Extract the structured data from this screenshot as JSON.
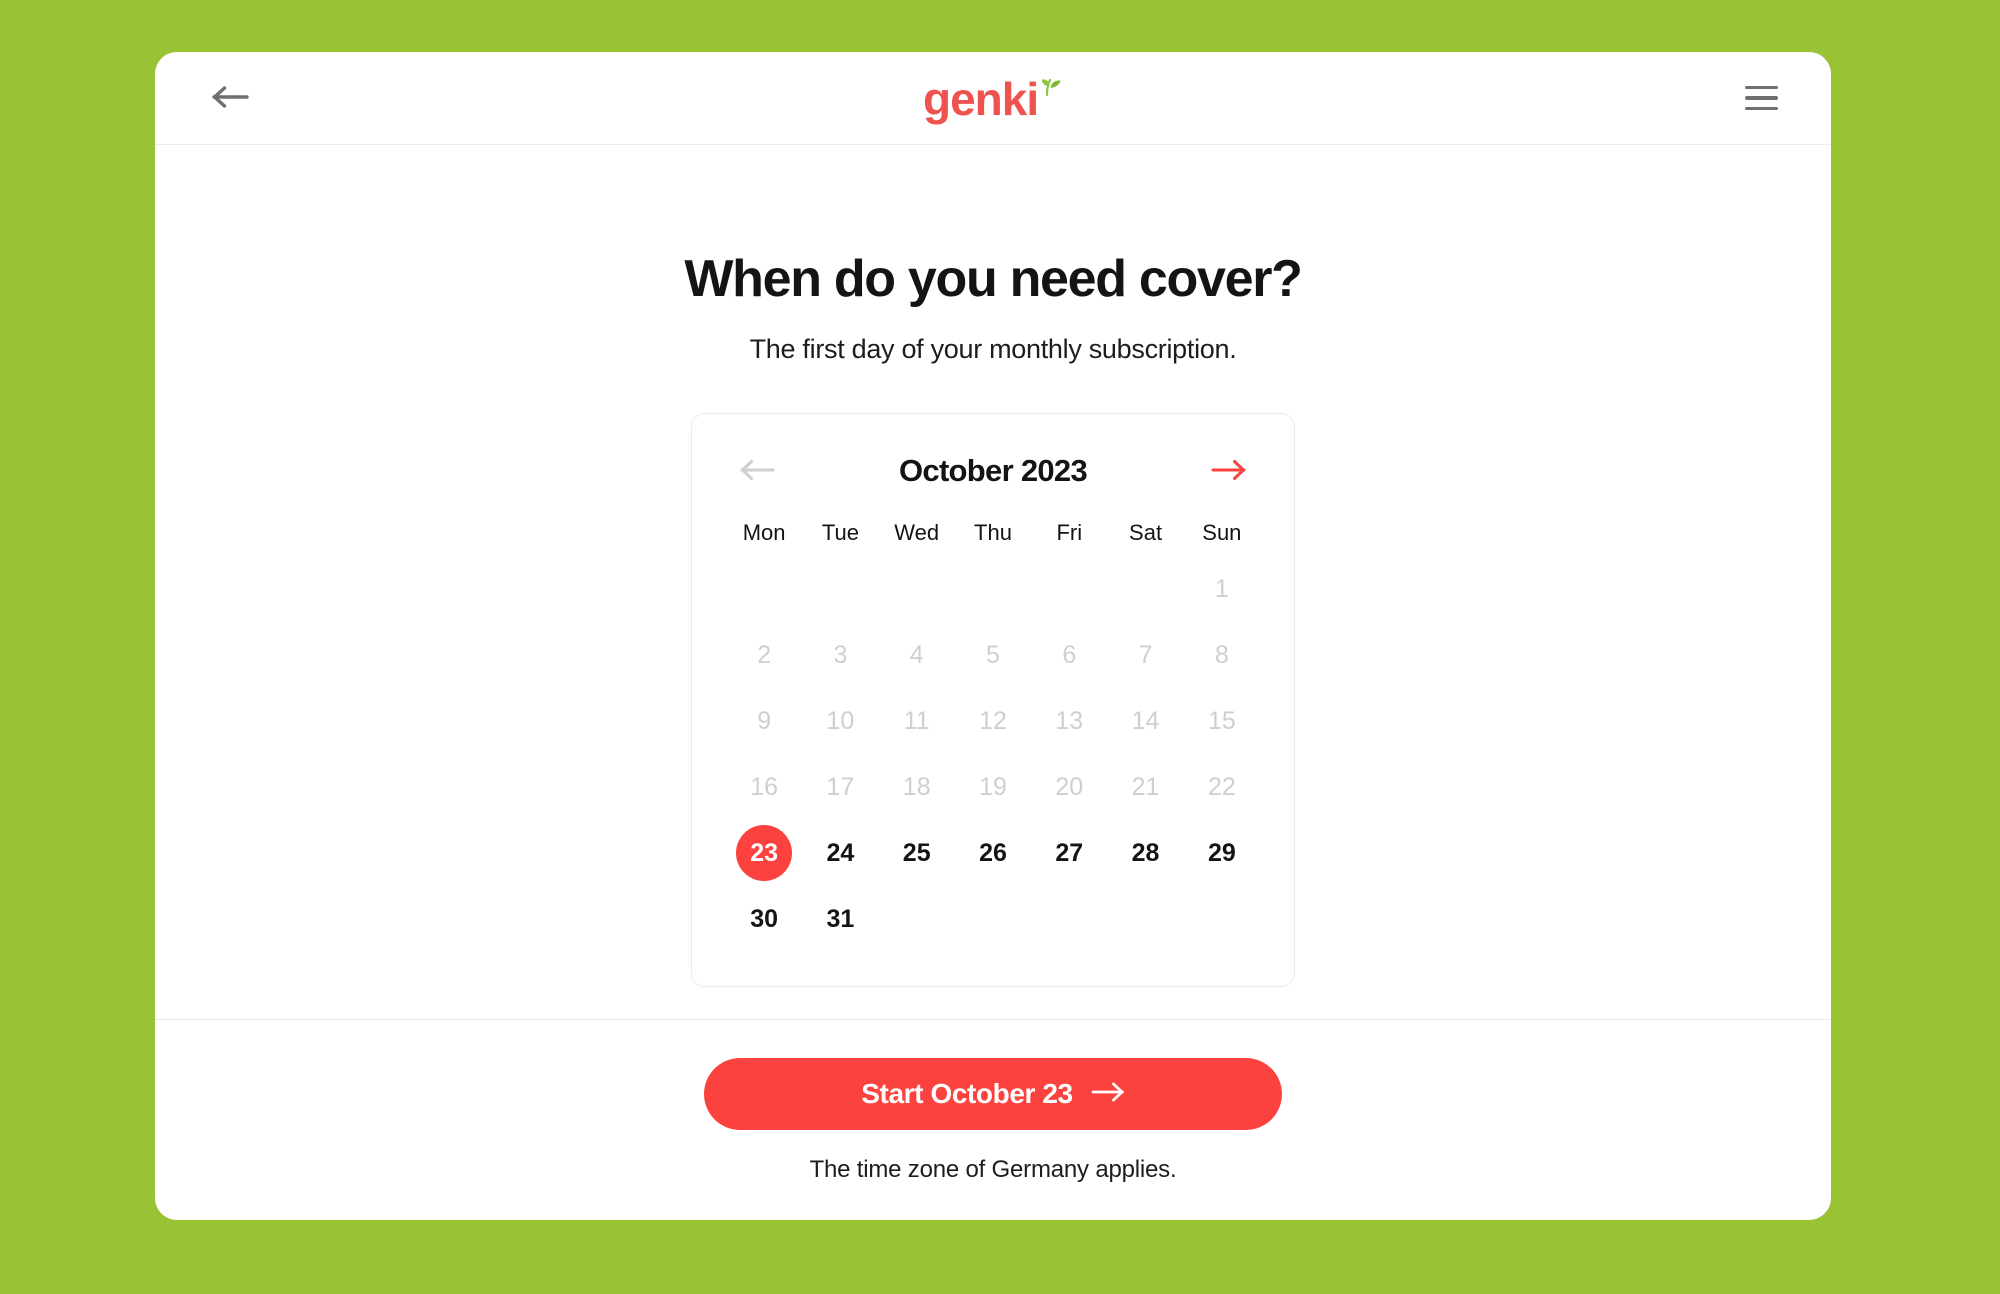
{
  "theme": {
    "page_background": "#9ac235",
    "accent_red": "#fb423e",
    "leaf_green": "#8cc63e",
    "panel_background": "#ffffff",
    "disabled_gray": "#cfcfd2"
  },
  "header": {
    "back_icon": "arrow-left-icon",
    "menu_icon": "hamburger-menu-icon",
    "logo_text": "genki",
    "logo_leaf": "leaf-sprout-icon"
  },
  "main": {
    "title": "When do you need cover?",
    "subtitle": "The first day of your monthly subscription."
  },
  "calendar": {
    "month_label": "October 2023",
    "prev_icon": "arrow-left-icon",
    "next_icon": "arrow-right-icon",
    "prev_enabled": false,
    "next_enabled": true,
    "weekdays": [
      "Mon",
      "Tue",
      "Wed",
      "Thu",
      "Fri",
      "Sat",
      "Sun"
    ],
    "leading_blanks": 6,
    "selected_day": 23,
    "first_selectable_day": 23,
    "days": [
      {
        "n": "1",
        "state": "disabled"
      },
      {
        "n": "2",
        "state": "disabled"
      },
      {
        "n": "3",
        "state": "disabled"
      },
      {
        "n": "4",
        "state": "disabled"
      },
      {
        "n": "5",
        "state": "disabled"
      },
      {
        "n": "6",
        "state": "disabled"
      },
      {
        "n": "7",
        "state": "disabled"
      },
      {
        "n": "8",
        "state": "disabled"
      },
      {
        "n": "9",
        "state": "disabled"
      },
      {
        "n": "10",
        "state": "disabled"
      },
      {
        "n": "11",
        "state": "disabled"
      },
      {
        "n": "12",
        "state": "disabled"
      },
      {
        "n": "13",
        "state": "disabled"
      },
      {
        "n": "14",
        "state": "disabled"
      },
      {
        "n": "15",
        "state": "disabled"
      },
      {
        "n": "16",
        "state": "disabled"
      },
      {
        "n": "17",
        "state": "disabled"
      },
      {
        "n": "18",
        "state": "disabled"
      },
      {
        "n": "19",
        "state": "disabled"
      },
      {
        "n": "20",
        "state": "disabled"
      },
      {
        "n": "21",
        "state": "disabled"
      },
      {
        "n": "22",
        "state": "disabled"
      },
      {
        "n": "23",
        "state": "selected"
      },
      {
        "n": "24",
        "state": "enabled"
      },
      {
        "n": "25",
        "state": "enabled"
      },
      {
        "n": "26",
        "state": "enabled"
      },
      {
        "n": "27",
        "state": "enabled"
      },
      {
        "n": "28",
        "state": "enabled"
      },
      {
        "n": "29",
        "state": "enabled"
      },
      {
        "n": "30",
        "state": "enabled"
      },
      {
        "n": "31",
        "state": "enabled"
      }
    ]
  },
  "footer": {
    "cta_label": "Start October 23",
    "cta_icon": "arrow-right-icon",
    "note": "The time zone of Germany applies."
  }
}
